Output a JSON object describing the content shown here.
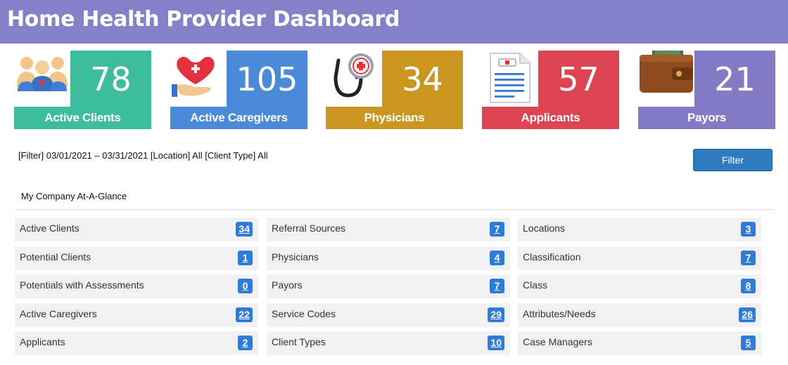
{
  "header": {
    "title": "Home Health Provider Dashboard"
  },
  "cards": [
    {
      "value": "78",
      "label": "Active Clients",
      "color": "#3dbd9b",
      "icon": "people-group-icon"
    },
    {
      "value": "105",
      "label": "Active Caregivers",
      "color": "#4a8ad8",
      "icon": "caring-hand-heart-icon"
    },
    {
      "value": "34",
      "label": "Physicians",
      "color": "#c9961f",
      "icon": "stethoscope-icon"
    },
    {
      "value": "57",
      "label": "Applicants",
      "color": "#dd4452",
      "icon": "application-document-icon"
    },
    {
      "value": "21",
      "label": "Payors",
      "color": "#857bc4",
      "icon": "wallet-icon"
    }
  ],
  "filter": {
    "summary": "[Filter] 03/01/2021 – 03/31/2021 [Location] All [Client Type] All",
    "button_label": "Filter"
  },
  "glance": {
    "title": "My Company At-A-Glance",
    "columns": [
      [
        {
          "label": "Active Clients",
          "count": "34"
        },
        {
          "label": "Potential Clients",
          "count": "1"
        },
        {
          "label": "Potentials with Assessments",
          "count": "0"
        },
        {
          "label": "Active Caregivers",
          "count": "22"
        },
        {
          "label": "Applicants",
          "count": "2"
        }
      ],
      [
        {
          "label": "Referral Sources",
          "count": "7"
        },
        {
          "label": "Physicians",
          "count": "4"
        },
        {
          "label": "Payors",
          "count": "7"
        },
        {
          "label": "Service Codes",
          "count": "29"
        },
        {
          "label": "Client Types",
          "count": "10"
        }
      ],
      [
        {
          "label": "Locations",
          "count": "3"
        },
        {
          "label": "Classification",
          "count": "7"
        },
        {
          "label": "Class",
          "count": "8"
        },
        {
          "label": "Attributes/Needs",
          "count": "26"
        },
        {
          "label": "Case Managers",
          "count": "5"
        }
      ]
    ]
  }
}
